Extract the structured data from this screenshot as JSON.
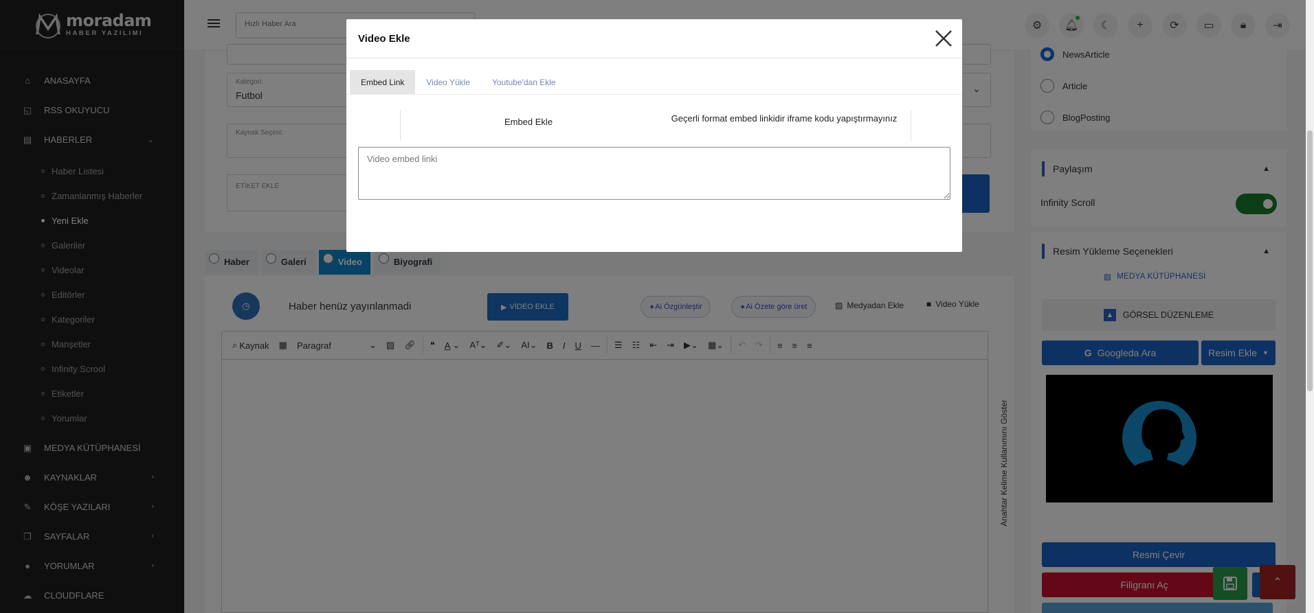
{
  "brand": {
    "name": "moradam",
    "subtitle": "HABER YAZILIMI"
  },
  "sidebar": {
    "items": [
      {
        "label": "ANASAYFA",
        "icon": "home-icon"
      },
      {
        "label": "RSS OKUYUCU",
        "icon": "rss-icon"
      },
      {
        "label": "HABERLER",
        "icon": "newspaper-icon"
      }
    ],
    "sub_items": [
      "Haber Listesi",
      "Zamanlanmış Haberler",
      "Yeni Ekle",
      "Galeriler",
      "Videolar",
      "Editörler",
      "Kategoriler",
      "Manşetler",
      "Infinity Scrool",
      "Etiketler",
      "Yorumlar"
    ],
    "lower_items": [
      {
        "label": "MEDYA KÜTÜPHANESİ",
        "icon": "image-icon"
      },
      {
        "label": "KAYNAKLAR",
        "icon": "users-icon"
      },
      {
        "label": "KÖŞE YAZILARI",
        "icon": "pen-icon"
      },
      {
        "label": "SAYFALAR",
        "icon": "pages-icon"
      },
      {
        "label": "YORUMLAR",
        "icon": "comment-icon"
      },
      {
        "label": "CLOUDFLARE",
        "icon": "cloud-icon"
      }
    ]
  },
  "topbar": {
    "search_placeholder": "Hızlı Haber Ara"
  },
  "form": {
    "category_label": "Kategori:",
    "category_value": "Futbol",
    "source_label": "Kaynak Seçimi:",
    "tag_label": "ETİKET EKLE"
  },
  "type_tabs": [
    "Haber",
    "Galeri",
    "Video",
    "Biyografi"
  ],
  "editor": {
    "status": "Haber henüz yayınlanmadi",
    "video_button": "VİDEO EKLE",
    "ai_original": "Ai Özgünleştir",
    "ai_summary": "Ai Özete göre üret",
    "media_add": "Medyadan Ekle",
    "video_upload": "Video Yükle",
    "source": "Kaynak",
    "paragraph": "Paragraf",
    "vertical_label": "Anahtar Kelime Kullanımını Göster"
  },
  "right_panel": {
    "schema_options": [
      "NewsArticle",
      "Article",
      "BlogPosting"
    ],
    "share_title": "Paylaşım",
    "infinity_scroll": "Infinity Scroll",
    "upload_title": "Resim Yükleme Seçenekleri",
    "media_library": "MEDYA KÜTÜPHANESİ",
    "image_edit": "GÖRSEL DÜZENLEME",
    "google_search": "Googleda Ara",
    "add_image": "Resim Ekle",
    "rotate": "Resmi Çevir",
    "watermark": "Filigranı Aç",
    "accent_blue": "#1b63c4",
    "accent_red": "#c8102e"
  },
  "modal": {
    "title": "Video Ekle",
    "tabs": [
      "Embed Link",
      "Video Yükle",
      "Youtube'dan Ekle"
    ],
    "embed_heading": "Embed Ekle",
    "embed_hint": "Geçerli format embed linkidir iframe kodu yapıştırmayınız",
    "embed_placeholder": "Video embed linki"
  }
}
